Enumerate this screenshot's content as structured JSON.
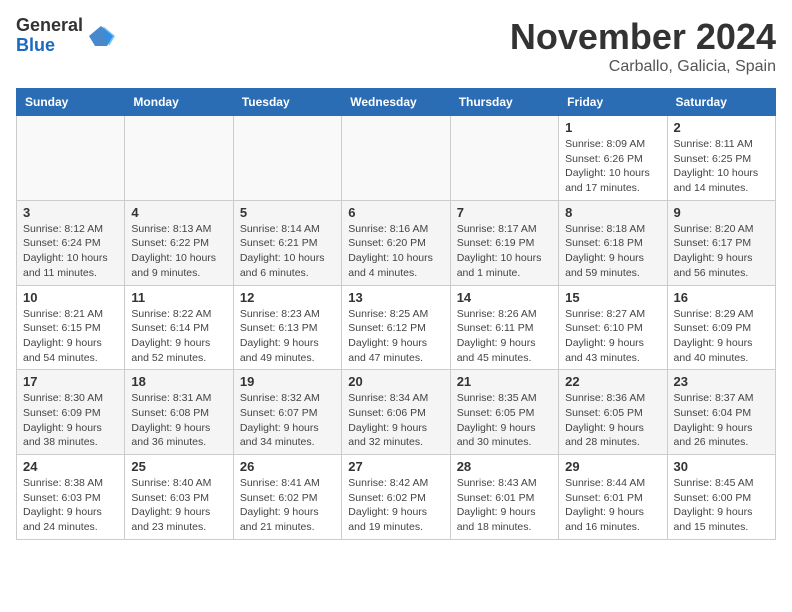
{
  "logo": {
    "general": "General",
    "blue": "Blue"
  },
  "title": "November 2024",
  "location": "Carballo, Galicia, Spain",
  "weekdays": [
    "Sunday",
    "Monday",
    "Tuesday",
    "Wednesday",
    "Thursday",
    "Friday",
    "Saturday"
  ],
  "weeks": [
    [
      {
        "day": "",
        "info": ""
      },
      {
        "day": "",
        "info": ""
      },
      {
        "day": "",
        "info": ""
      },
      {
        "day": "",
        "info": ""
      },
      {
        "day": "",
        "info": ""
      },
      {
        "day": "1",
        "info": "Sunrise: 8:09 AM\nSunset: 6:26 PM\nDaylight: 10 hours and 17 minutes."
      },
      {
        "day": "2",
        "info": "Sunrise: 8:11 AM\nSunset: 6:25 PM\nDaylight: 10 hours and 14 minutes."
      }
    ],
    [
      {
        "day": "3",
        "info": "Sunrise: 8:12 AM\nSunset: 6:24 PM\nDaylight: 10 hours and 11 minutes."
      },
      {
        "day": "4",
        "info": "Sunrise: 8:13 AM\nSunset: 6:22 PM\nDaylight: 10 hours and 9 minutes."
      },
      {
        "day": "5",
        "info": "Sunrise: 8:14 AM\nSunset: 6:21 PM\nDaylight: 10 hours and 6 minutes."
      },
      {
        "day": "6",
        "info": "Sunrise: 8:16 AM\nSunset: 6:20 PM\nDaylight: 10 hours and 4 minutes."
      },
      {
        "day": "7",
        "info": "Sunrise: 8:17 AM\nSunset: 6:19 PM\nDaylight: 10 hours and 1 minute."
      },
      {
        "day": "8",
        "info": "Sunrise: 8:18 AM\nSunset: 6:18 PM\nDaylight: 9 hours and 59 minutes."
      },
      {
        "day": "9",
        "info": "Sunrise: 8:20 AM\nSunset: 6:17 PM\nDaylight: 9 hours and 56 minutes."
      }
    ],
    [
      {
        "day": "10",
        "info": "Sunrise: 8:21 AM\nSunset: 6:15 PM\nDaylight: 9 hours and 54 minutes."
      },
      {
        "day": "11",
        "info": "Sunrise: 8:22 AM\nSunset: 6:14 PM\nDaylight: 9 hours and 52 minutes."
      },
      {
        "day": "12",
        "info": "Sunrise: 8:23 AM\nSunset: 6:13 PM\nDaylight: 9 hours and 49 minutes."
      },
      {
        "day": "13",
        "info": "Sunrise: 8:25 AM\nSunset: 6:12 PM\nDaylight: 9 hours and 47 minutes."
      },
      {
        "day": "14",
        "info": "Sunrise: 8:26 AM\nSunset: 6:11 PM\nDaylight: 9 hours and 45 minutes."
      },
      {
        "day": "15",
        "info": "Sunrise: 8:27 AM\nSunset: 6:10 PM\nDaylight: 9 hours and 43 minutes."
      },
      {
        "day": "16",
        "info": "Sunrise: 8:29 AM\nSunset: 6:09 PM\nDaylight: 9 hours and 40 minutes."
      }
    ],
    [
      {
        "day": "17",
        "info": "Sunrise: 8:30 AM\nSunset: 6:09 PM\nDaylight: 9 hours and 38 minutes."
      },
      {
        "day": "18",
        "info": "Sunrise: 8:31 AM\nSunset: 6:08 PM\nDaylight: 9 hours and 36 minutes."
      },
      {
        "day": "19",
        "info": "Sunrise: 8:32 AM\nSunset: 6:07 PM\nDaylight: 9 hours and 34 minutes."
      },
      {
        "day": "20",
        "info": "Sunrise: 8:34 AM\nSunset: 6:06 PM\nDaylight: 9 hours and 32 minutes."
      },
      {
        "day": "21",
        "info": "Sunrise: 8:35 AM\nSunset: 6:05 PM\nDaylight: 9 hours and 30 minutes."
      },
      {
        "day": "22",
        "info": "Sunrise: 8:36 AM\nSunset: 6:05 PM\nDaylight: 9 hours and 28 minutes."
      },
      {
        "day": "23",
        "info": "Sunrise: 8:37 AM\nSunset: 6:04 PM\nDaylight: 9 hours and 26 minutes."
      }
    ],
    [
      {
        "day": "24",
        "info": "Sunrise: 8:38 AM\nSunset: 6:03 PM\nDaylight: 9 hours and 24 minutes."
      },
      {
        "day": "25",
        "info": "Sunrise: 8:40 AM\nSunset: 6:03 PM\nDaylight: 9 hours and 23 minutes."
      },
      {
        "day": "26",
        "info": "Sunrise: 8:41 AM\nSunset: 6:02 PM\nDaylight: 9 hours and 21 minutes."
      },
      {
        "day": "27",
        "info": "Sunrise: 8:42 AM\nSunset: 6:02 PM\nDaylight: 9 hours and 19 minutes."
      },
      {
        "day": "28",
        "info": "Sunrise: 8:43 AM\nSunset: 6:01 PM\nDaylight: 9 hours and 18 minutes."
      },
      {
        "day": "29",
        "info": "Sunrise: 8:44 AM\nSunset: 6:01 PM\nDaylight: 9 hours and 16 minutes."
      },
      {
        "day": "30",
        "info": "Sunrise: 8:45 AM\nSunset: 6:00 PM\nDaylight: 9 hours and 15 minutes."
      }
    ]
  ]
}
